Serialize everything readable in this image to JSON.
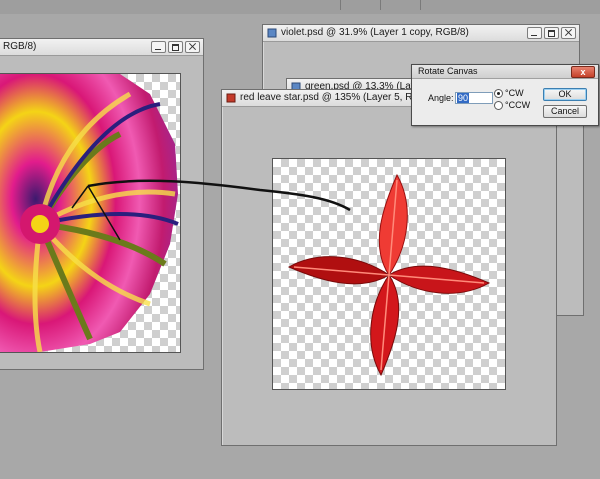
{
  "windows": {
    "embroidery": {
      "title": "RGB/8)"
    },
    "violet": {
      "title": "violet.psd @ 31.9% (Layer 1 copy, RGB/8)"
    },
    "green": {
      "title": "green.psd @ 13.3% (Layer 1 copy"
    },
    "red_leaf": {
      "title": "red leave star.psd @ 135% (Layer 5, RGB/8)"
    }
  },
  "dialog": {
    "title": "Rotate Canvas",
    "close_label": "x",
    "angle_label": "Angle:",
    "angle_value": "90",
    "cw_label": "°CW",
    "ccw_label": "°CCW",
    "cw_selected": true,
    "ok_label": "OK",
    "cancel_label": "Cancel"
  },
  "colors": {
    "workspace": "#a8a8a8",
    "doc_frame": "#bcbcbc",
    "leaf_dark": "#b00f10",
    "leaf_light": "#ef3b34",
    "dialog_close": "#c4412a"
  }
}
